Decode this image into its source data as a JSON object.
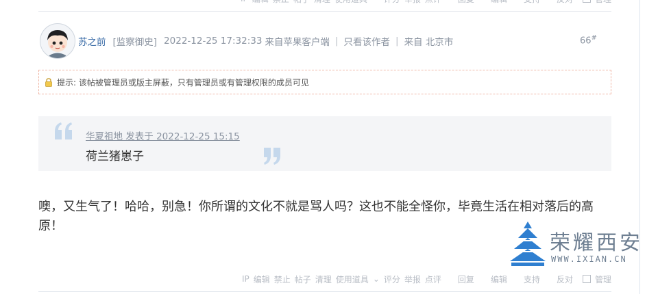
{
  "toolbar_items": [
    "IP",
    "编辑",
    "禁止",
    "帖子",
    "清理",
    "使用道具",
    "评分",
    "举报",
    "点评",
    "回复",
    "编辑",
    "支持",
    "反对",
    "管理"
  ],
  "post": {
    "author": "苏之前",
    "rank": "[监察御史]",
    "datetime": "2022-12-25 17:32:33",
    "source": "来自苹果客户端",
    "only_author": "只看该作者",
    "location": "来自 北京市",
    "floor": "66",
    "floor_mark": "#"
  },
  "notice": {
    "text": "提示: 该帖被管理员或版主屏蔽，只有管理员或有管理权限的成员可见"
  },
  "quote": {
    "meta": "华夏祖地 发表于 2022-12-25 15:15",
    "text": "荷兰猪崽子"
  },
  "body": {
    "text": "噢，又生气了！哈哈，别急！你所谓的文化不就是骂人吗？这也不能全怪你，毕竟生活在相对落后的高原！"
  },
  "watermark": {
    "name": "荣耀西安",
    "url": "WWW.IXIAN.CN"
  },
  "icons": {
    "notice": "lock-icon",
    "quote_open": "quote-open-icon",
    "quote_close": "quote-close-icon"
  },
  "colors": {
    "author_link": "#3d6ea8",
    "meta_gray": "#8a93a0",
    "notice_border": "#f0b7a6",
    "quote_bg": "#f4f5f7",
    "quote_mark": "#c5d8ec"
  }
}
